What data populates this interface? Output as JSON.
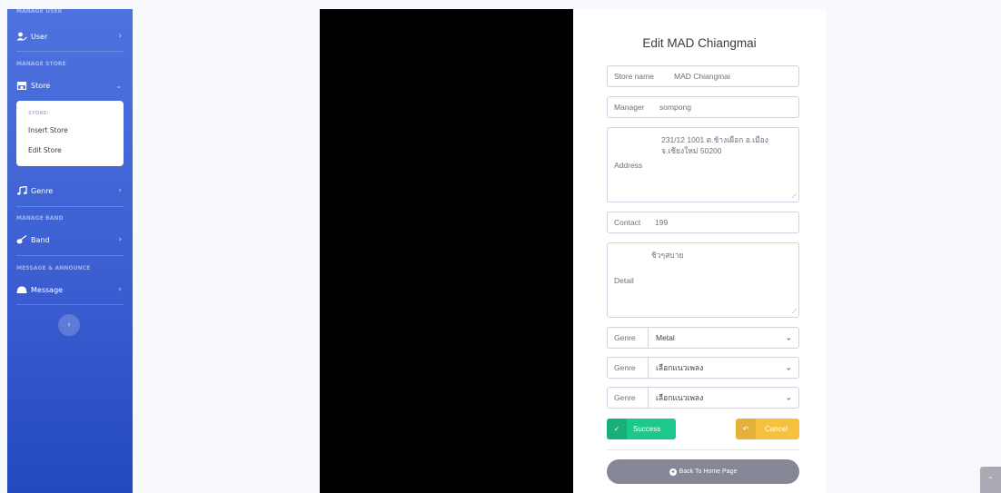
{
  "sidebar": {
    "headings": {
      "manage_user": "MANAGE USER",
      "manage_store": "MANAGE STORE",
      "manage_band": "MANAGE BAND",
      "message": "MESSAGE & ANNOUNCE"
    },
    "items": {
      "user": "User",
      "store": "Store",
      "genre": "Genre",
      "band": "Band",
      "message": "Message"
    },
    "store_submenu": {
      "header": "STORE:",
      "insert": "Insert Store",
      "edit": "Edit Store"
    }
  },
  "form": {
    "title": "Edit MAD Chiangmai",
    "store_name": {
      "label": "Store name",
      "value": "MAD Chiangmai"
    },
    "manager": {
      "label": "Manager",
      "value": "sompong"
    },
    "address": {
      "label": "Address",
      "line1": "231/12 1001 ต.ช้างเผือก อ.เมือง",
      "line2": "จ.เชียงใหม่ 50200"
    },
    "contact": {
      "label": "Contact",
      "value": "199"
    },
    "detail": {
      "label": "Detail",
      "value": "ชิวๆสบาย"
    },
    "genre1": {
      "label": "Genre",
      "value": "Metal"
    },
    "genre2": {
      "label": "Genre",
      "value": "เลือกแนวเพลง"
    },
    "genre3": {
      "label": "Genre",
      "value": "เลือกแนวเพลง"
    },
    "success_label": "Success",
    "cancel_label": "Cancel",
    "home_label": "Back To Home Page"
  },
  "colors": {
    "sidebar": "#4e73df",
    "success": "#1cc88a",
    "cancel": "#f6c23e",
    "home": "#858796"
  },
  "icons": [
    "user-icon",
    "store-icon",
    "music-icon",
    "guitar-icon",
    "message-icon",
    "check-icon",
    "undo-icon",
    "home-icon",
    "chevron-up-icon",
    "chevron-left-icon"
  ]
}
